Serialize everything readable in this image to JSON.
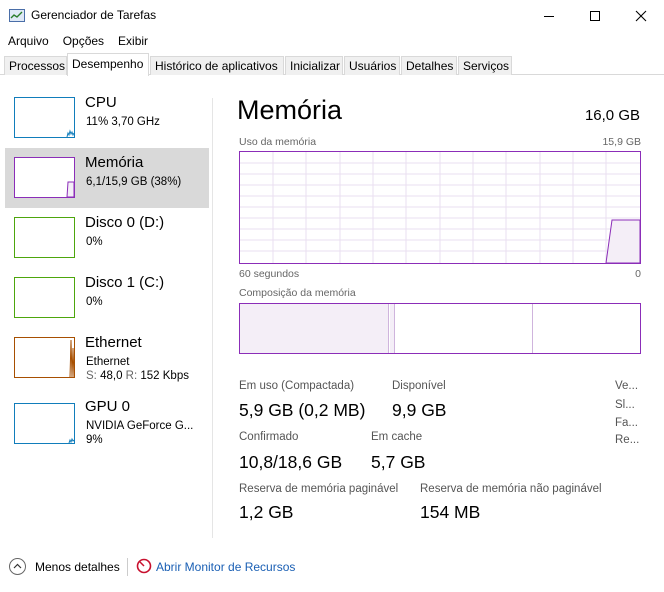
{
  "window": {
    "title": "Gerenciador de Tarefas"
  },
  "menu": [
    "Arquivo",
    "Opções",
    "Exibir"
  ],
  "tabs": [
    "Processos",
    "Desempenho",
    "Histórico de aplicativos",
    "Inicializar",
    "Usuários",
    "Detalhes",
    "Serviços"
  ],
  "active_tab": "Desempenho",
  "sidebar": {
    "items": [
      {
        "name": "CPU",
        "sub": "11%  3,70 GHz",
        "sub2": "",
        "color": "#117dbb"
      },
      {
        "name": "Memória",
        "sub": "6,1/15,9 GB (38%)",
        "sub2": "",
        "color": "#8b2db8",
        "selected": true
      },
      {
        "name": "Disco 0 (D:)",
        "sub": "0%",
        "sub2": "",
        "color": "#4da60c"
      },
      {
        "name": "Disco 1 (C:)",
        "sub": "0%",
        "sub2": "",
        "color": "#4da60c"
      },
      {
        "name": "Ethernet",
        "sub": "Ethernet",
        "sub2_s_label": "S:",
        "sub2_s_value": "48,0",
        "sub2_r_label": "R:",
        "sub2_r_value": "152 Kbps",
        "color": "#a74f01"
      },
      {
        "name": "GPU 0",
        "sub": "NVIDIA GeForce G...",
        "sub2": "9%",
        "color": "#117dbb"
      }
    ]
  },
  "main": {
    "title": "Memória",
    "total": "16,0 GB",
    "usage_label": "Uso da memória",
    "usage_max": "15,9 GB",
    "time_left": "60 segundos",
    "time_right": "0",
    "composition_label": "Composição da memória",
    "usage_fraction": 0.38,
    "stats": {
      "in_use_label": "Em uso (Compactada)",
      "in_use_value": "5,9 GB (0,2 MB)",
      "available_label": "Disponível",
      "available_value": "9,9 GB",
      "committed_label": "Confirmado",
      "committed_value": "10,8/18,6 GB",
      "cached_label": "Em cache",
      "cached_value": "5,7 GB",
      "paged_label": "Reserva de memória paginável",
      "paged_value": "1,2 GB",
      "nonpaged_label": "Reserva de memória não paginável",
      "nonpaged_value": "154 MB"
    },
    "right_labels": [
      "Ve...",
      "Sl...",
      "Fa...",
      "Re..."
    ]
  },
  "footer": {
    "less_details": "Menos detalhes",
    "resource_monitor": "Abrir Monitor de Recursos"
  },
  "colors": {
    "memory": "#8b2db8",
    "cpu": "#117dbb",
    "disk": "#4da60c",
    "ethernet": "#a74f01",
    "link": "#1a5fb4"
  }
}
